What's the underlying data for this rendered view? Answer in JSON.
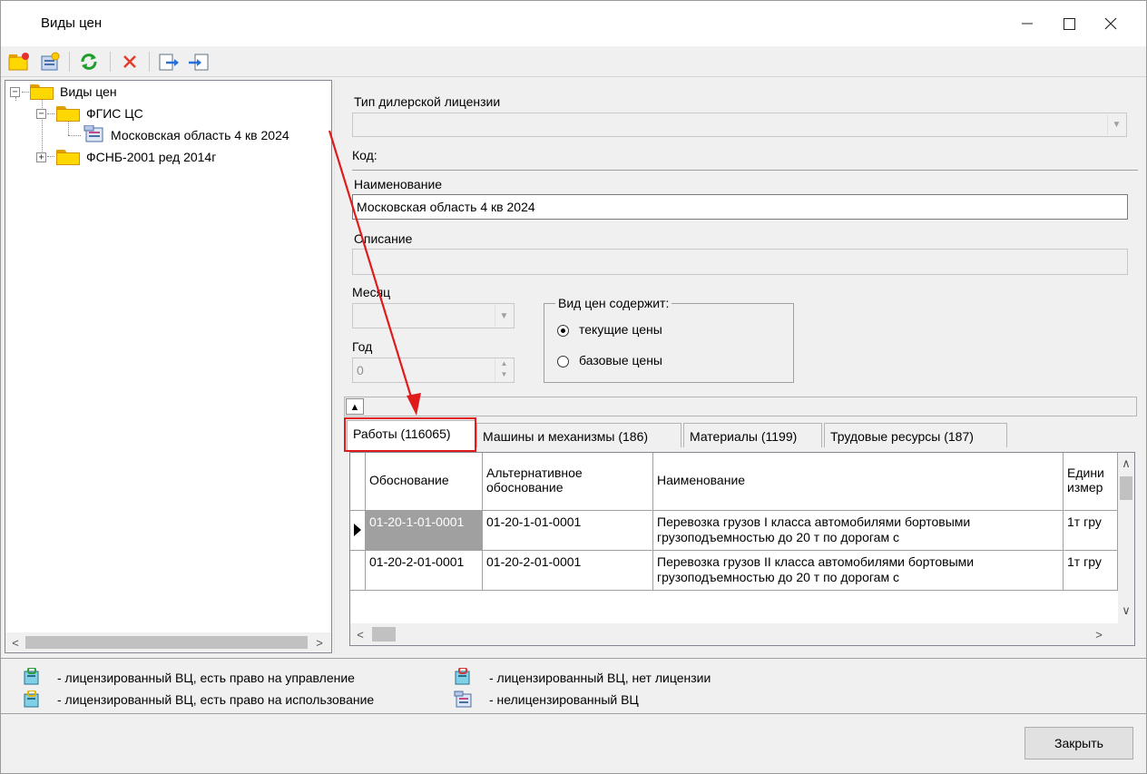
{
  "window": {
    "title": "Виды цен"
  },
  "window_controls": [
    "minimize-icon",
    "maximize-icon",
    "close-icon"
  ],
  "toolbar": {
    "buttons": [
      {
        "name": "new-folder-button",
        "icon": "folder-new-icon"
      },
      {
        "name": "new-price-type-button",
        "icon": "document-new-icon"
      },
      {
        "name": "refresh-button",
        "icon": "refresh-icon"
      },
      {
        "name": "delete-button",
        "icon": "delete-x-icon"
      },
      {
        "name": "export-button",
        "icon": "export-icon"
      },
      {
        "name": "import-button",
        "icon": "import-icon"
      }
    ]
  },
  "tree": {
    "root": "Виды цен",
    "children": [
      {
        "label": "ФГИС ЦС",
        "expanded": true,
        "children": [
          {
            "label": "Московская область 4 кв 2024",
            "selected": true
          }
        ]
      },
      {
        "label": "ФСНБ-2001 ред 2014г",
        "expanded": false
      }
    ]
  },
  "form": {
    "license_type_label": "Тип дилерской лицензии",
    "license_type_value": "",
    "code_label": "Код:",
    "name_label": "Наименование",
    "name_value": "Московская область 4 кв 2024",
    "description_label": "Описание",
    "description_value": "",
    "month_label": "Месяц",
    "month_value": "",
    "year_label": "Год",
    "year_value": "0",
    "contains_label": "Вид цен содержит:",
    "radio_current": "текущие цены",
    "radio_base": "базовые цены",
    "selected_radio": "current"
  },
  "tabs": [
    {
      "label": "Работы (116065)",
      "active": true
    },
    {
      "label": "Машины и механизмы (186)",
      "active": false
    },
    {
      "label": "Материалы (1199)",
      "active": false
    },
    {
      "label": "Трудовые ресурсы (187)",
      "active": false
    }
  ],
  "grid": {
    "columns": [
      "Обоснование",
      "Альтернативное обоснование",
      "Наименование",
      "Единица измерения"
    ],
    "columns_visible_text": [
      "Обоснование",
      "Альтернативное обоснование",
      "Наименование",
      "Едини измер"
    ],
    "rows": [
      {
        "code": "01-20-1-01-0001",
        "alt": "01-20-1-01-0001",
        "name": "Перевозка грузов I класса автомобилями бортовыми грузоподъемностью до 20 т по дорогам с",
        "unit": "1т гру",
        "current": true
      },
      {
        "code": "01-20-2-01-0001",
        "alt": "01-20-2-01-0001",
        "name": "Перевозка грузов II класса автомобилями бортовыми грузоподъемностью до 20 т по дорогам с",
        "unit": "1т гру",
        "current": false
      }
    ]
  },
  "legend": [
    {
      "icon": "licensed-manage-icon",
      "text": "- лицензированный ВЦ, есть право на управление"
    },
    {
      "icon": "licensed-no-license-icon",
      "text": "- лицензированный ВЦ, нет лицензии"
    },
    {
      "icon": "licensed-use-icon",
      "text": "- лицензированный ВЦ, есть право на использование"
    },
    {
      "icon": "unlicensed-icon",
      "text": "- нелицензированный ВЦ"
    }
  ],
  "close_button": "Закрыть",
  "colors": {
    "annotation_red": "#e01b1b",
    "folder_yellow": "#ffd800",
    "selection_gray": "#a0a0a0"
  }
}
